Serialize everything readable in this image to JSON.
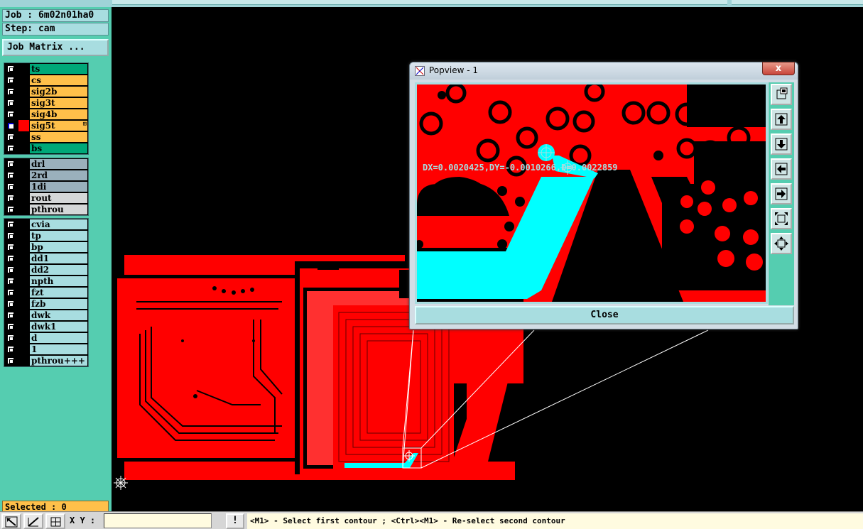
{
  "job": {
    "job_line": "Job : 6m02n01ha0",
    "step_line": "Step: cam",
    "matrix_button": "Job Matrix ..."
  },
  "layers_board": [
    {
      "name": "ts",
      "color": "green"
    },
    {
      "name": "cs",
      "color": "orange"
    },
    {
      "name": "sig2b",
      "color": "orange"
    },
    {
      "name": "sig3t",
      "color": "orange"
    },
    {
      "name": "sig4b",
      "color": "orange"
    },
    {
      "name": "sig5t",
      "color": "orange",
      "active": true
    },
    {
      "name": "ss",
      "color": "orange"
    },
    {
      "name": "bs",
      "color": "green"
    }
  ],
  "layers_drill": [
    {
      "name": "drl",
      "color": "gray"
    },
    {
      "name": "2rd",
      "color": "gray"
    },
    {
      "name": "1di",
      "color": "gray"
    },
    {
      "name": "rout",
      "color": "lgray"
    },
    {
      "name": "pthrou",
      "color": "lgray"
    }
  ],
  "layers_misc": [
    {
      "name": "cvia"
    },
    {
      "name": "tp"
    },
    {
      "name": "bp"
    },
    {
      "name": "dd1"
    },
    {
      "name": "dd2"
    },
    {
      "name": "npth"
    },
    {
      "name": "fzt"
    },
    {
      "name": "fzb"
    },
    {
      "name": "dwk"
    },
    {
      "name": "dwk1"
    },
    {
      "name": "d"
    },
    {
      "name": "1"
    },
    {
      "name": "pthrou+++"
    }
  ],
  "status": {
    "selected": "Selected : 0"
  },
  "bottom": {
    "xy_label": "X Y :",
    "xy_value": "",
    "warning_glyph": "!",
    "prompt": "<M1> - Select first contour ; <Ctrl><M1> - Re-select second contour"
  },
  "popview": {
    "title": "Popview - 1",
    "close_x": "x",
    "measurement": "DX=0.0020425,DY=-0.0010266,D=0.0022859",
    "close_button": "Close"
  },
  "colors": {
    "copper": "#ff0000",
    "highlight": "#00ffff",
    "panel": "#55cdb0",
    "active_layer": "#ffc04a"
  }
}
